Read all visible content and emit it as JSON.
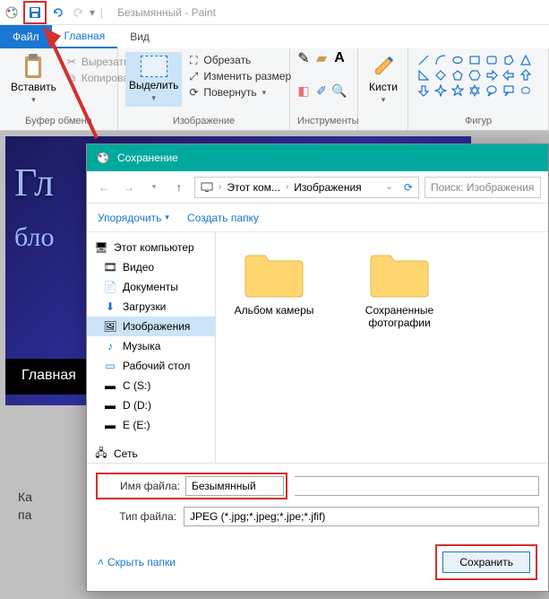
{
  "title": "Безымянный - Paint",
  "tabs": {
    "file": "Файл",
    "home": "Главная",
    "view": "Вид"
  },
  "ribbon": {
    "clipboard": {
      "label": "Буфер обмена",
      "paste": "Вставить",
      "cut": "Вырезать",
      "copy": "Копировать"
    },
    "image": {
      "label": "Изображение",
      "select": "Выделить",
      "crop": "Обрезать",
      "resize": "Изменить размер",
      "rotate": "Повернуть"
    },
    "tools": {
      "label": "Инструменты"
    },
    "brushes": {
      "label": "Кисти",
      "btn": "Кисти"
    },
    "shapes": {
      "label": "Фигур"
    }
  },
  "canvas": {
    "text1": "Гл",
    "text2": "бло",
    "strip": "Главная",
    "below1": "Ка",
    "below2": "па"
  },
  "dialog": {
    "title": "Сохранение",
    "nav": {
      "thispc": "Этот ком...",
      "folder": "Изображения"
    },
    "search_placeholder": "Поиск: Изображения",
    "tools": {
      "organize": "Упорядочить",
      "newfolder": "Создать папку"
    },
    "tree": {
      "thispc": "Этот компьютер",
      "videos": "Видео",
      "documents": "Документы",
      "downloads": "Загрузки",
      "pictures": "Изображения",
      "music": "Музыка",
      "desktop": "Рабочий стол",
      "c": "C (S:)",
      "d": "D (D:)",
      "e": "E (E:)",
      "network": "Сеть"
    },
    "folders": {
      "camera": "Альбом камеры",
      "saved": "Сохраненные фотографии"
    },
    "filename_label": "Имя файла:",
    "filename_value": "Безымянный",
    "filetype_label": "Тип файла:",
    "filetype_value": "JPEG (*.jpg;*.jpeg;*.jpe;*.jfif)",
    "hide_folders": "Скрыть папки",
    "save_btn": "Сохранить"
  }
}
